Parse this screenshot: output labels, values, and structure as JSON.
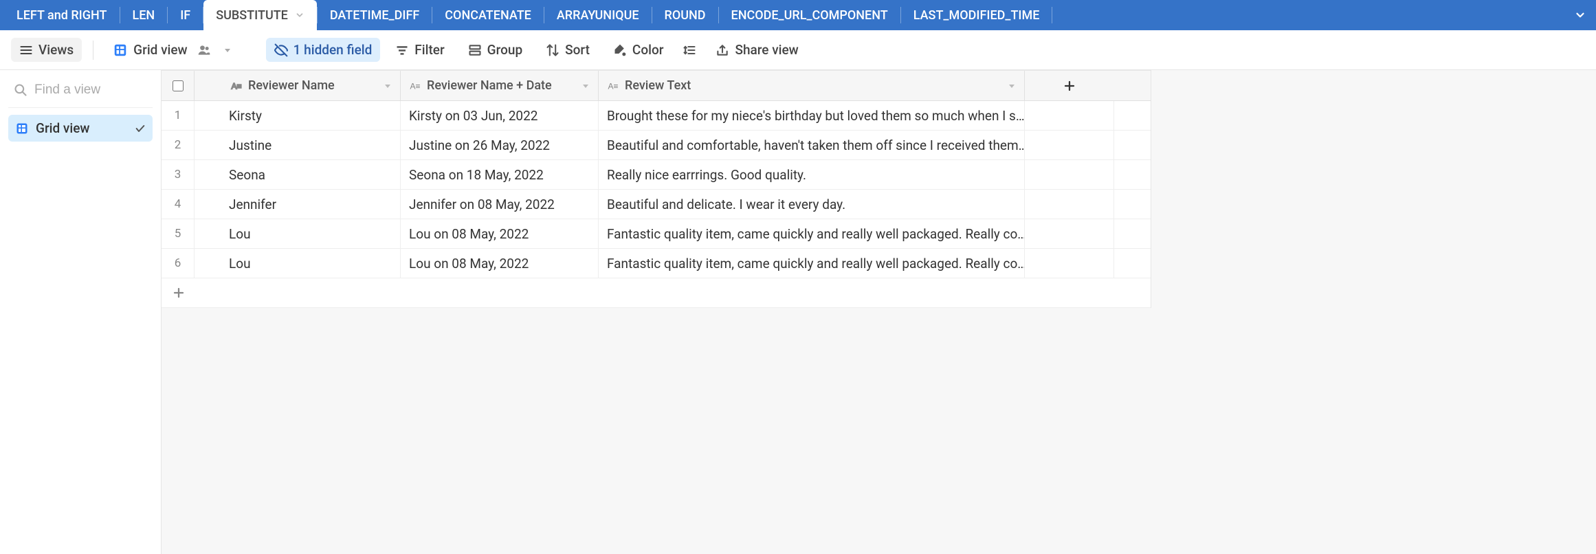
{
  "tabs": {
    "items": [
      "LEFT and RIGHT",
      "LEN",
      "IF",
      "SUBSTITUTE",
      "DATETIME_DIFF",
      "CONCATENATE",
      "ARRAYUNIQUE",
      "ROUND",
      "ENCODE_URL_COMPONENT",
      "LAST_MODIFIED_TIME"
    ],
    "active_index": 3
  },
  "toolbar": {
    "views_label": "Views",
    "grid_view_label": "Grid view",
    "hidden_field_label": "1 hidden field",
    "filter_label": "Filter",
    "group_label": "Group",
    "sort_label": "Sort",
    "color_label": "Color",
    "share_label": "Share view"
  },
  "sidebar": {
    "search_placeholder": "Find a view",
    "views": [
      {
        "label": "Grid view"
      }
    ]
  },
  "grid": {
    "columns": [
      {
        "label": "Reviewer Name"
      },
      {
        "label": "Reviewer Name + Date"
      },
      {
        "label": "Review Text"
      }
    ],
    "rows": [
      {
        "num": "1",
        "name": "Kirsty",
        "name_date": "Kirsty on 03 Jun, 2022",
        "review": "Brought these for my niece's birthday but loved them so much when I s…"
      },
      {
        "num": "2",
        "name": "Justine",
        "name_date": "Justine on 26 May, 2022",
        "review": "Beautiful and comfortable, haven't taken them off since I received them…"
      },
      {
        "num": "3",
        "name": "Seona",
        "name_date": "Seona on 18 May, 2022",
        "review": "Really nice earrrings. Good quality."
      },
      {
        "num": "4",
        "name": "Jennifer",
        "name_date": "Jennifer on 08 May, 2022",
        "review": "Beautiful and delicate. I wear it every day."
      },
      {
        "num": "5",
        "name": "Lou",
        "name_date": "Lou on 08 May, 2022",
        "review": "Fantastic quality item, came quickly and really well packaged. Really co…"
      },
      {
        "num": "6",
        "name": "Lou",
        "name_date": "Lou on 08 May, 2022",
        "review": "Fantastic quality item, came quickly and really well packaged. Really co…"
      }
    ]
  }
}
